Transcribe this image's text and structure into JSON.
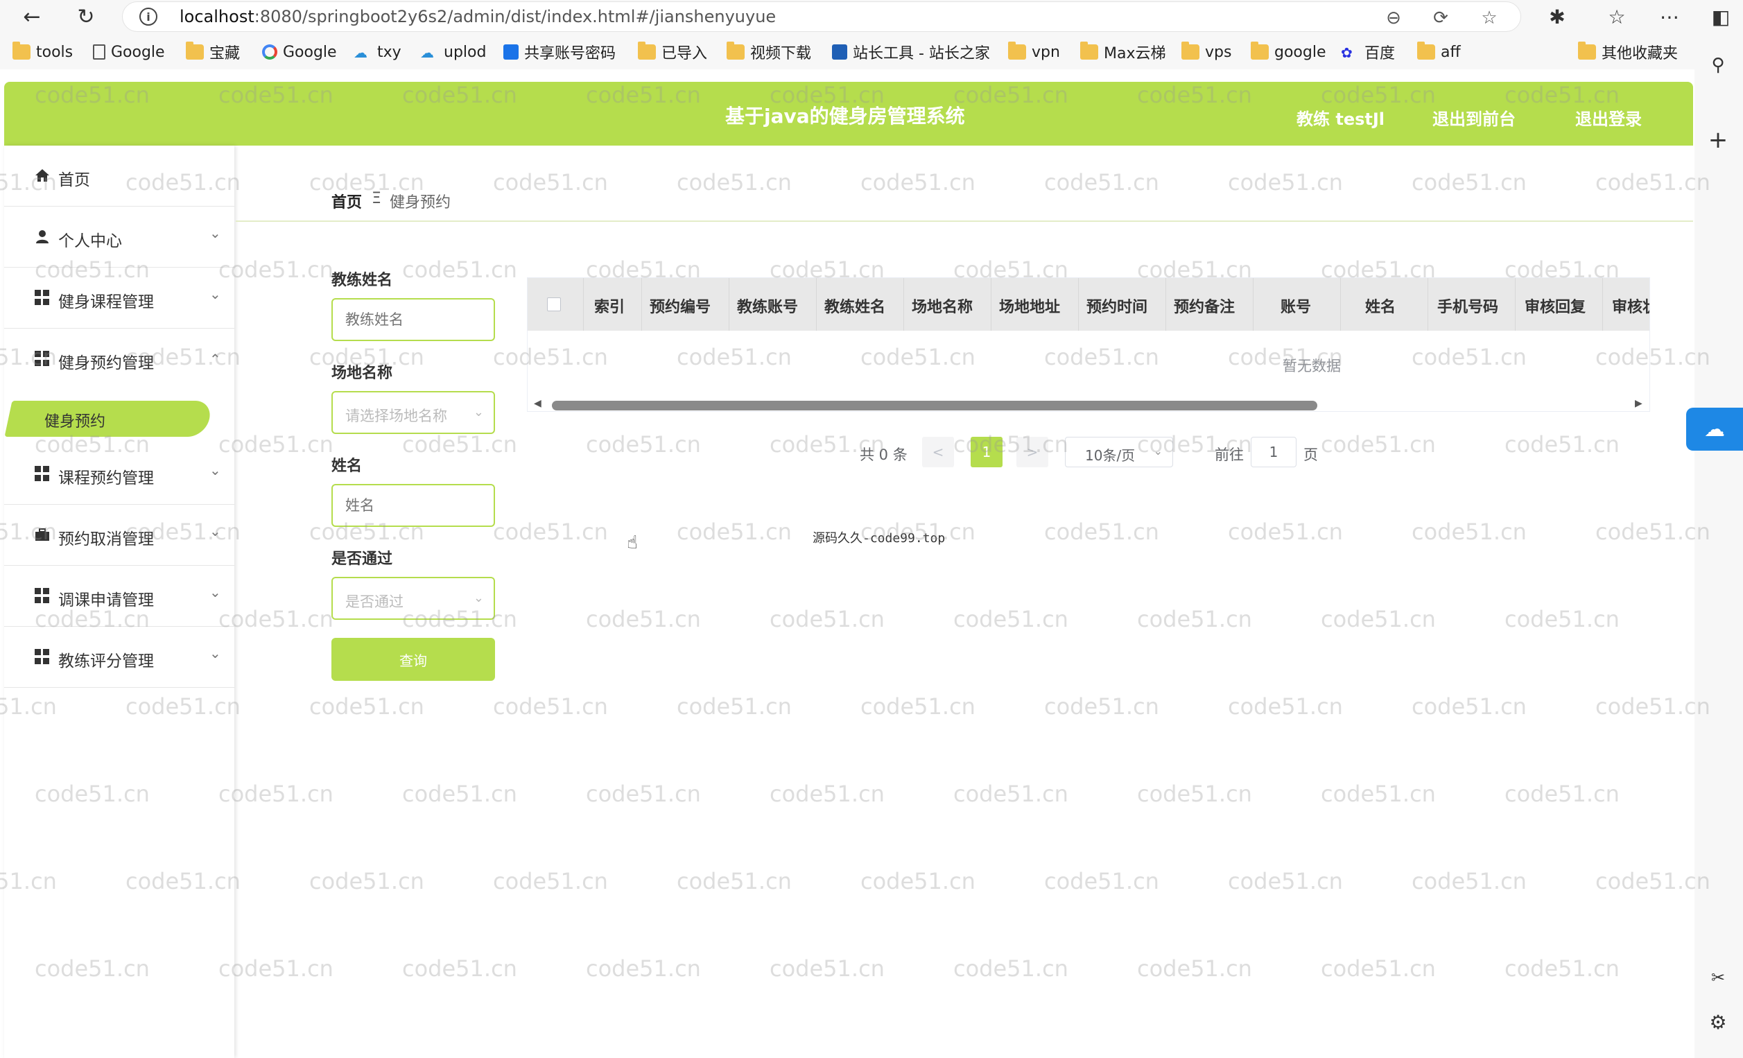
{
  "browser": {
    "url_host": "localhost",
    "url_path": ":8080/springboot2y6s2/admin/dist/index.html#/jianshenyuyue",
    "bookmarks": [
      "tools",
      "Google",
      "宝藏",
      "Google",
      "txy",
      "uplod",
      "共享账号密码",
      "已导入",
      "视频下载",
      "站长工具 - 站长之家",
      "vpn",
      "Max云梯",
      "vps",
      "google",
      "百度",
      "aff"
    ],
    "other_bookmarks": "其他收藏夹"
  },
  "header": {
    "title": "基于java的健身房管理系统",
    "user": "教练 testJl",
    "to_front": "退出到前台",
    "logout": "退出登录"
  },
  "sidebar": {
    "items": [
      {
        "label": "首页",
        "icon": "home-icon"
      },
      {
        "label": "个人中心",
        "icon": "user-icon"
      },
      {
        "label": "健身课程管理",
        "icon": "grid-icon"
      },
      {
        "label": "健身预约管理",
        "icon": "grid-icon"
      },
      {
        "label": "课程预约管理",
        "icon": "grid-icon"
      },
      {
        "label": "预约取消管理",
        "icon": "briefcase-icon"
      },
      {
        "label": "调课申请管理",
        "icon": "grid-icon"
      },
      {
        "label": "教练评分管理",
        "icon": "grid-icon"
      }
    ],
    "active_sub": "健身预约"
  },
  "breadcrumb": {
    "home": "首页",
    "separator": "Ξ",
    "current": "健身预约"
  },
  "search": {
    "coach_label": "教练姓名",
    "coach_placeholder": "教练姓名",
    "venue_label": "场地名称",
    "venue_placeholder": "请选择场地名称",
    "name_label": "姓名",
    "name_placeholder": "姓名",
    "pass_label": "是否通过",
    "pass_placeholder": "是否通过",
    "query_button": "查询"
  },
  "table": {
    "columns": [
      "索引",
      "预约编号",
      "教练账号",
      "教练姓名",
      "场地名称",
      "场地地址",
      "预约时间",
      "预约备注",
      "账号",
      "姓名",
      "手机号码",
      "审核回复",
      "审核状"
    ],
    "empty_text": "暂无数据"
  },
  "pagination": {
    "total": "共 0 条",
    "prev": "<",
    "current_page": "1",
    "next": ">",
    "page_size": "10条/页",
    "goto_prefix": "前往",
    "goto_value": "1",
    "goto_suffix": "页"
  },
  "footer_note": "源码久久-code99.top",
  "watermark": "code51.cn",
  "colors": {
    "accent": "#b5dd4d",
    "header_text": "#ffffff"
  }
}
